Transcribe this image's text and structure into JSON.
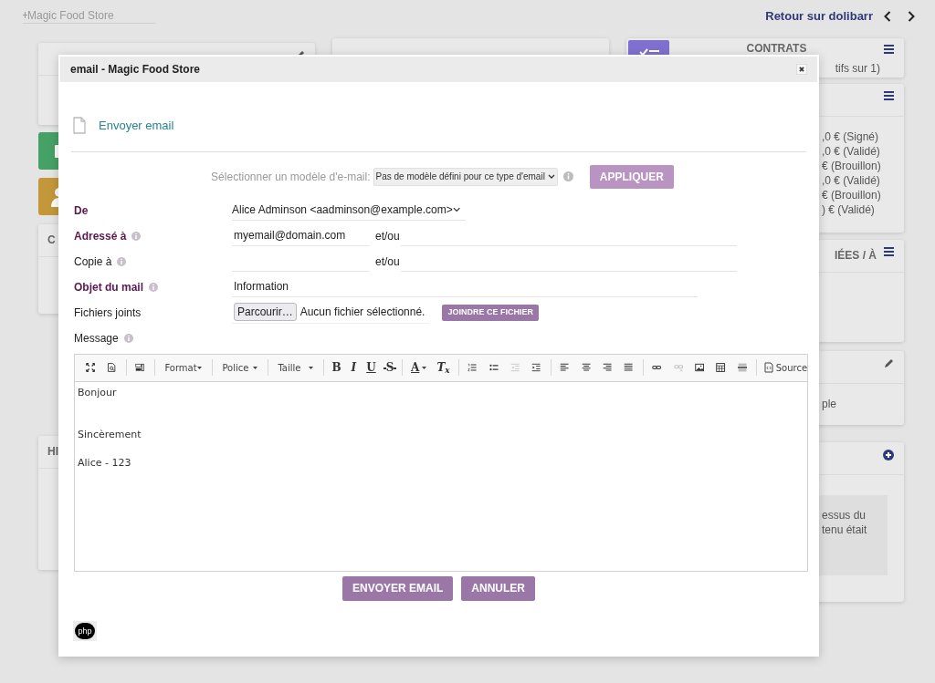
{
  "page": {
    "search": {
      "placeholder": "Magic Food Store"
    },
    "back_link": "Retour sur dolibarr"
  },
  "background": {
    "left": [
      {
        "kind": "card"
      },
      {
        "kind": "tile",
        "color": "#45a166"
      },
      {
        "kind": "tile",
        "color": "#c4973a"
      },
      {
        "kind": "card",
        "title": "C"
      },
      {
        "kind": "card",
        "title": "HI"
      }
    ],
    "middle": [
      {
        "kind": "card"
      }
    ],
    "right": [
      {
        "kind": "stat",
        "title": "CONTRATS",
        "lines": [
          "tifs sur 1)"
        ]
      },
      {
        "kind": "card",
        "lines": [
          ",0 € (Signé)",
          ",0 € (Validé)",
          "€ (Brouillon)",
          ",0 € (Validé)",
          "€ (Brouillon)",
          ") € (Validé)"
        ]
      },
      {
        "kind": "card",
        "title": "IÉES / À"
      },
      {
        "kind": "card",
        "lines": [
          "ple"
        ]
      },
      {
        "kind": "note",
        "lines": [
          "essus du",
          "tenu était"
        ]
      }
    ]
  },
  "dialog": {
    "title": "email - Magic Food Store",
    "heading": "Envoyer email",
    "template": {
      "label": "Sélectionner un modèle d'e-mail:",
      "value": "Pas de modèle défini pour ce type d'email",
      "button": "APPLIQUER",
      "disabled": true
    },
    "fields": [
      {
        "kind": "select",
        "label": "De",
        "required": true,
        "info": false,
        "value": "Alice Adminson <aadminson@example.com>"
      },
      {
        "kind": "recipients",
        "label": "Adressé à",
        "required": true,
        "info": true,
        "value": "myemail@domain.com",
        "joiner": "et/ou"
      },
      {
        "kind": "recipients",
        "label": "Copie à",
        "required": false,
        "info": true,
        "joiner": "et/ou"
      },
      {
        "kind": "text",
        "label": "Objet du mail",
        "required": true,
        "info": true,
        "value": "Information"
      },
      {
        "kind": "file",
        "label": "Fichiers joints",
        "required": false,
        "info": false,
        "browse": "Parcourir…",
        "file_status": "Aucun fichier sélectionné.",
        "attach_button": "JOINDRE CE FICHIER"
      },
      {
        "kind": "label",
        "label": "Message",
        "required": false,
        "info": true
      }
    ],
    "editor": {
      "toolbar": [
        {
          "kind": "icon",
          "disabled": false
        },
        {
          "kind": "icon",
          "disabled": false
        },
        {
          "kind": "separator"
        },
        {
          "kind": "icon",
          "disabled": false
        },
        {
          "kind": "separator"
        },
        {
          "kind": "dropdown",
          "label": "Format"
        },
        {
          "kind": "separator"
        },
        {
          "kind": "dropdown",
          "label": "Police"
        },
        {
          "kind": "separator"
        },
        {
          "kind": "dropdown",
          "label": "Taille"
        },
        {
          "kind": "separator"
        },
        {
          "kind": "glyph",
          "label": "B"
        },
        {
          "kind": "glyph",
          "label": "I"
        },
        {
          "kind": "glyph",
          "label": "U"
        },
        {
          "kind": "glyph",
          "label": "S"
        },
        {
          "kind": "separator"
        },
        {
          "kind": "glyph",
          "label": "A"
        },
        {
          "kind": "glyph",
          "label": "T$_{x}$"
        },
        {
          "kind": "separator"
        },
        {
          "kind": "icon",
          "disabled": false
        },
        {
          "kind": "icon",
          "disabled": false
        },
        {
          "kind": "icon",
          "disabled": true
        },
        {
          "kind": "icon",
          "disabled": false
        },
        {
          "kind": "separator"
        },
        {
          "kind": "icon",
          "disabled": false
        },
        {
          "kind": "icon",
          "disabled": false
        },
        {
          "kind": "icon",
          "disabled": false
        },
        {
          "kind": "icon",
          "disabled": false
        },
        {
          "kind": "separator"
        },
        {
          "kind": "icon",
          "disabled": false
        },
        {
          "kind": "icon",
          "disabled": true
        },
        {
          "kind": "icon",
          "disabled": false
        },
        {
          "kind": "icon",
          "disabled": false
        },
        {
          "kind": "icon",
          "disabled": false
        },
        {
          "kind": "separator"
        },
        {
          "kind": "source",
          "label": "Source"
        }
      ],
      "content": "Bonjour\n\n\nSincèrement\n\nAlice - 123"
    },
    "buttons": [
      "ENVOYER EMAIL",
      "ANNULER"
    ],
    "footer_badge": "php"
  }
}
